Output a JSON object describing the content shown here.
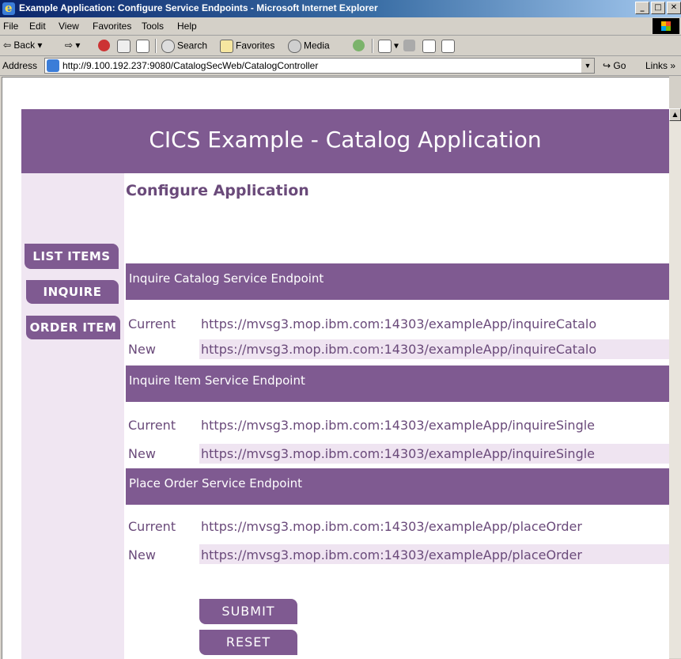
{
  "window": {
    "title": "Example Application: Configure Service Endpoints - Microsoft Internet Explorer"
  },
  "menu": [
    "File",
    "Edit",
    "View",
    "Favorites",
    "Tools",
    "Help"
  ],
  "toolbar": {
    "back": "Back",
    "search": "Search",
    "favorites": "Favorites",
    "media": "Media"
  },
  "address": {
    "label": "Address",
    "url": "http://9.100.192.237:9080/CatalogSecWeb/CatalogController",
    "go": "Go",
    "links": "Links"
  },
  "page": {
    "header": "CICS Example - Catalog Application",
    "title": "Configure Application",
    "nav": [
      "LIST ITEMS",
      "INQUIRE",
      "ORDER ITEM"
    ],
    "sections": [
      {
        "title": "Inquire Catalog Service Endpoint",
        "current_label": "Current",
        "current": "https://mvsg3.mop.ibm.com:14303/exampleApp/inquireCatalo",
        "new_label": "New",
        "new": "https://mvsg3.mop.ibm.com:14303/exampleApp/inquireCatalo"
      },
      {
        "title": "Inquire Item Service Endpoint",
        "current_label": "Current",
        "current": "https://mvsg3.mop.ibm.com:14303/exampleApp/inquireSingle",
        "new_label": "New",
        "new": "https://mvsg3.mop.ibm.com:14303/exampleApp/inquireSingle"
      },
      {
        "title": "Place Order Service Endpoint",
        "current_label": "Current",
        "current": "https://mvsg3.mop.ibm.com:14303/exampleApp/placeOrder",
        "new_label": "New",
        "new": "https://mvsg3.mop.ibm.com:14303/exampleApp/placeOrder"
      }
    ],
    "submit": "SUBMIT",
    "reset": "RESET"
  }
}
